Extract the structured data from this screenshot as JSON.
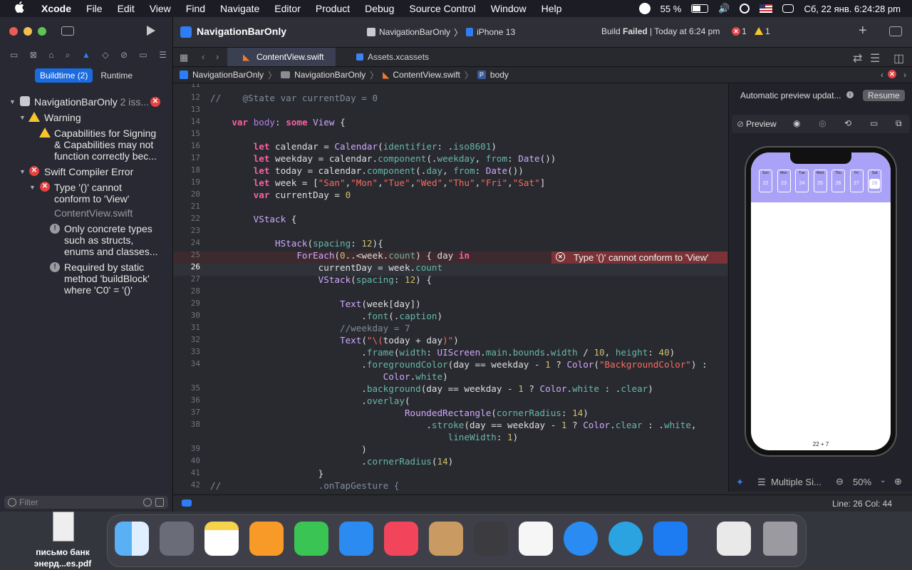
{
  "menubar": {
    "app": "Xcode",
    "items": [
      "File",
      "Edit",
      "View",
      "Find",
      "Navigate",
      "Editor",
      "Product",
      "Debug",
      "Source Control",
      "Window",
      "Help"
    ],
    "battery": "55 %",
    "datetime": "Сб, 22 янв.  6:24:28 pm"
  },
  "sidebar": {
    "segments": {
      "active": "Buildtime (2)",
      "inactive": "Runtime"
    },
    "project": {
      "name": "NavigationBarOnly",
      "count": "2 iss..."
    },
    "warning_group": "Warning",
    "warning_text": [
      "Capabilities for Signing",
      "& Capabilities may not",
      "function correctly bec..."
    ],
    "error_group": "Swift Compiler Error",
    "error_text": [
      "Type '()' cannot",
      "conform to 'View'"
    ],
    "error_file": "ContentView.swift",
    "note1": [
      "Only concrete types",
      "such as structs,",
      "enums and classes..."
    ],
    "note2": [
      "Required by static",
      "method 'buildBlock'",
      "where 'C0' = '()'"
    ],
    "filter_placeholder": "Filter"
  },
  "toolbar": {
    "project_title": "NavigationBarOnly",
    "scheme": "NavigationBarOnly",
    "device": "iPhone 13",
    "build_prefix": "Build ",
    "build_status": "Failed",
    "build_time": " | Today at 6:24 pm",
    "errors": "1",
    "warnings": "1"
  },
  "tabs": [
    {
      "label": "ContentView.swift"
    },
    {
      "label": "Assets.xcassets"
    }
  ],
  "jumpbar": [
    "NavigationBarOnly",
    "NavigationBarOnly",
    "ContentView.swift",
    "body"
  ],
  "editor": {
    "error_message": "Type '()' cannot conform to 'View'",
    "line_numbers": [
      "11",
      "12",
      "13",
      "14",
      "15",
      "16",
      "17",
      "18",
      "19",
      "20",
      "21",
      "22",
      "23",
      "24",
      "25",
      "26",
      "27",
      "28",
      "29",
      "30",
      "31",
      "32",
      "33",
      "34",
      "",
      "35",
      "36",
      "37",
      "38",
      "",
      "39",
      "40",
      "41",
      "42"
    ]
  },
  "preview": {
    "banner": "Automatic preview updat...",
    "resume": "Resume",
    "preview_label": "Preview",
    "days": [
      "Sun",
      "Mon",
      "Tue",
      "Wed",
      "Thu",
      "Fri",
      "Sat"
    ],
    "dates": [
      "22",
      "23",
      "24",
      "25",
      "26",
      "27",
      "28"
    ],
    "footer_text": "22 + 7",
    "device_label": "Multiple Si...",
    "zoom": "50%"
  },
  "status": {
    "position": "Line: 26  Col: 44"
  },
  "desktop": {
    "file_label_1": "письмо банк",
    "file_label_2": "энерд...es.pdf"
  }
}
